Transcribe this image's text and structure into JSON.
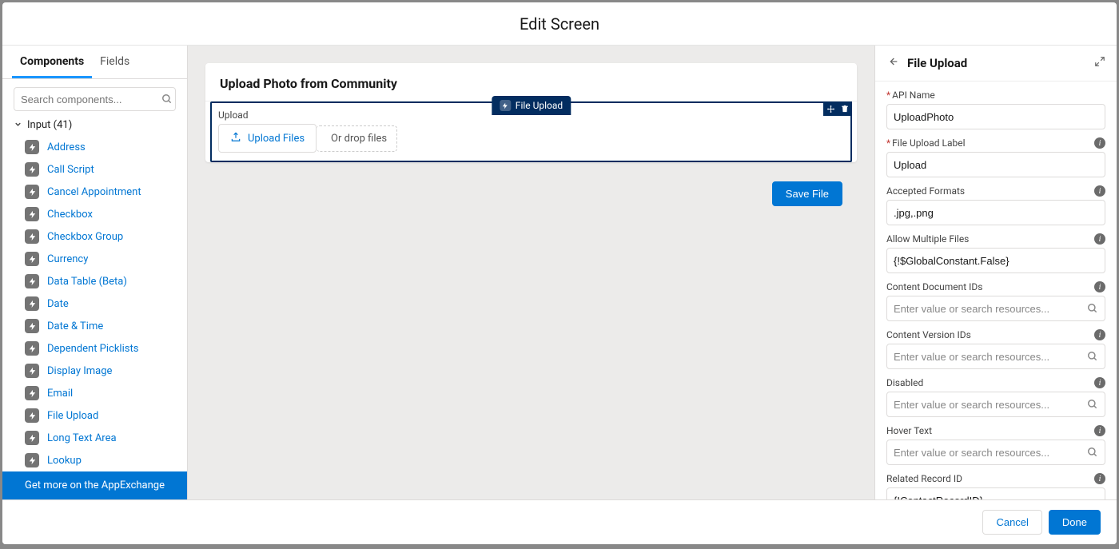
{
  "modal": {
    "title": "Edit Screen"
  },
  "left": {
    "tabs": {
      "components": "Components",
      "fields": "Fields"
    },
    "search_placeholder": "Search components...",
    "section_label": "Input (41)",
    "items": [
      "Address",
      "Call Script",
      "Cancel Appointment",
      "Checkbox",
      "Checkbox Group",
      "Currency",
      "Data Table (Beta)",
      "Date",
      "Date & Time",
      "Dependent Picklists",
      "Display Image",
      "Email",
      "File Upload",
      "Long Text Area",
      "Lookup"
    ],
    "appexchange": "Get more on the AppExchange"
  },
  "canvas": {
    "screen_title": "Upload Photo from Community",
    "selected_badge": "File Upload",
    "upload_label": "Upload",
    "upload_button": "Upload Files",
    "drop_hint": "Or drop files",
    "save_button": "Save File"
  },
  "right": {
    "title": "File Upload",
    "fields": {
      "api_name": {
        "label": "API Name",
        "value": "UploadPhoto",
        "required": true
      },
      "file_upload_label": {
        "label": "File Upload Label",
        "value": "Upload",
        "required": true,
        "info": true
      },
      "accepted_formats": {
        "label": "Accepted Formats",
        "value": ".jpg,.png",
        "info": true
      },
      "allow_multiple": {
        "label": "Allow Multiple Files",
        "value": "{!$GlobalConstant.False}",
        "info": true
      },
      "content_doc_ids": {
        "label": "Content Document IDs",
        "placeholder": "Enter value or search resources...",
        "info": true,
        "search": true
      },
      "content_version_ids": {
        "label": "Content Version IDs",
        "placeholder": "Enter value or search resources...",
        "info": true,
        "search": true
      },
      "disabled": {
        "label": "Disabled",
        "placeholder": "Enter value or search resources...",
        "info": true,
        "search": true
      },
      "hover_text": {
        "label": "Hover Text",
        "placeholder": "Enter value or search resources...",
        "info": true,
        "search": true
      },
      "related_record_id": {
        "label": "Related Record ID",
        "value": "{!ContactRecordID}",
        "info": true
      }
    }
  },
  "footer": {
    "cancel": "Cancel",
    "done": "Done"
  }
}
